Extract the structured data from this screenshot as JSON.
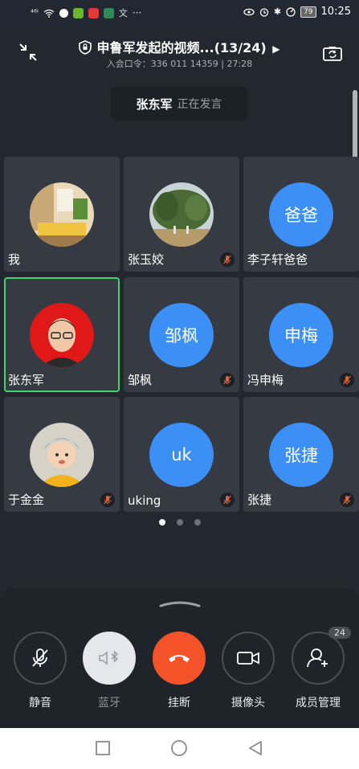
{
  "status_bar": {
    "signal": "⁴⁶ᴵ",
    "dots": "···",
    "battery": "79",
    "time": "10:25"
  },
  "header": {
    "title": "申鲁军发起的视频...(13/24)",
    "title_arrow": "▶",
    "subtitle": "入会口令：336 011 14359 | 27:28",
    "icons": {
      "collapse": "collapse-arrows-icon",
      "lock": "shield-lock-icon",
      "switch_camera": "switch-camera-icon"
    }
  },
  "speaker": {
    "name": "张东军",
    "status": "正在发言"
  },
  "participants": [
    {
      "name": "我",
      "avatar_type": "photo",
      "muted": false,
      "active": false
    },
    {
      "name": "张玉姣",
      "avatar_type": "photo",
      "muted": true,
      "active": false
    },
    {
      "name": "李子轩爸爸",
      "avatar_type": "text",
      "avatar_text": "爸爸",
      "muted": false,
      "active": false
    },
    {
      "name": "张东军",
      "avatar_type": "photo",
      "muted": false,
      "active": true
    },
    {
      "name": "邹枫",
      "avatar_type": "text",
      "avatar_text": "邹枫",
      "muted": true,
      "active": false
    },
    {
      "name": "冯申梅",
      "avatar_type": "text",
      "avatar_text": "申梅",
      "muted": true,
      "active": false
    },
    {
      "name": "于金金",
      "avatar_type": "photo",
      "muted": true,
      "active": false
    },
    {
      "name": "uking",
      "avatar_type": "text",
      "avatar_text": "uk",
      "muted": true,
      "active": false
    },
    {
      "name": "张捷",
      "avatar_type": "text",
      "avatar_text": "张捷",
      "muted": true,
      "active": false
    }
  ],
  "pagination": {
    "pages": 3,
    "current": 1
  },
  "controls": {
    "mute_label": "静音",
    "bluetooth_label": "蓝牙",
    "hangup_label": "挂断",
    "camera_label": "摄像头",
    "members_label": "成员管理",
    "members_count": "24"
  },
  "colors": {
    "background": "#232730",
    "tile": "#363b43",
    "avatar_blue": "#3b8ff5",
    "active_border": "#3ed46a",
    "hangup": "#f4532a"
  }
}
